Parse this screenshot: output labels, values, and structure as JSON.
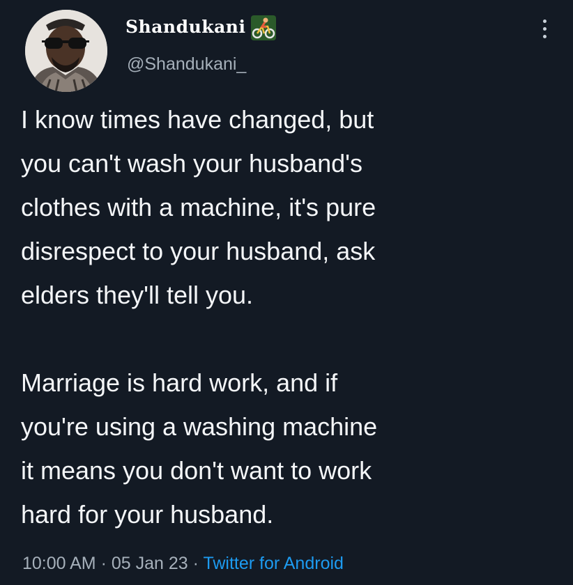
{
  "author": {
    "display_name": "Shandukani",
    "name_emoji": "bicyclist-emoji",
    "handle": "@Shandukani_",
    "avatar": "avatar-photo"
  },
  "more_icon": "more-vertical-icon",
  "tweet": {
    "lines": [
      "I know times have changed, but",
      "you can't wash your husband's",
      "clothes with a machine, it's pure",
      "disrespect to your husband, ask",
      "elders they'll tell you.",
      "",
      "Marriage is hard work, and if",
      "you're using a washing machine",
      "it means you don't want to work",
      "hard for your husband."
    ]
  },
  "meta": {
    "time": "10:00 AM",
    "separator1": " · ",
    "date": "05 Jan 23",
    "separator2": " · ",
    "source": "Twitter for Android"
  },
  "colors": {
    "background": "#131a24",
    "text": "#f4f6f8",
    "secondary": "#a6b0ba",
    "link": "#1d9bf0"
  }
}
